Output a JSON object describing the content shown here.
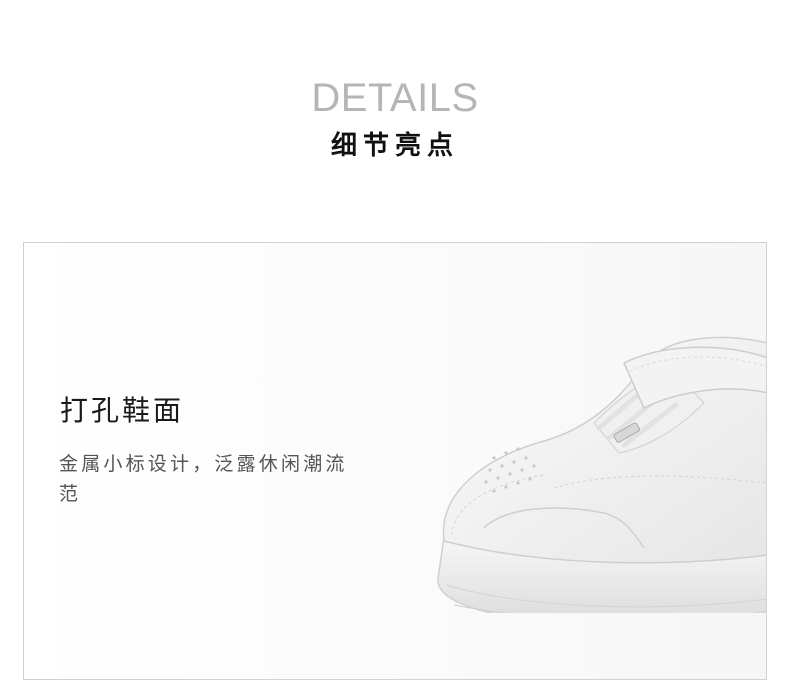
{
  "header": {
    "title_en": "DETAILS",
    "title_cn": "细节亮点"
  },
  "feature": {
    "title": "打孔鞋面",
    "description": "金属小标设计，泛露休闲潮流范"
  },
  "colors": {
    "en_title": "#b5b5b5",
    "cn_title": "#111111",
    "panel_border": "#d2d2d2",
    "body_text": "#555555"
  }
}
